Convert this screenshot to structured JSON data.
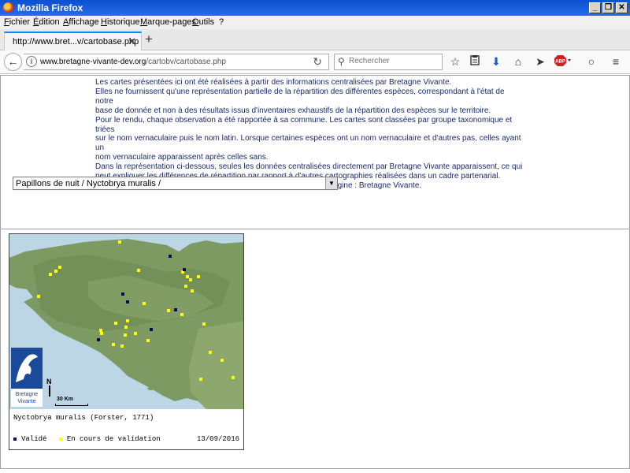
{
  "window": {
    "title": "Mozilla Firefox",
    "controls": [
      "_",
      "❐",
      "✕"
    ]
  },
  "menu": [
    "Fichier",
    "Édition",
    "Affichage",
    "Historique",
    "Marque-pages",
    "Outils",
    "?"
  ],
  "tab": {
    "label": "http://www.bret...v/cartobase.php",
    "close": "✕",
    "new": "+"
  },
  "nav": {
    "url_domain": "www.bretagne-vivante-dev.org",
    "url_path": "/cartobv/cartobase.php",
    "search_placeholder": "Rechercher",
    "adblock": "ABP"
  },
  "intro_lines": [
    "Les cartes présentées ici ont été réalisées à partir des informations centralisées par Bretagne Vivante.",
    "Elles ne fournissent qu'une représentation partielle de la répartition des différentes espèces, correspondant à l'état de notre",
    "base de donnée et non à des résultats issus d'inventaires exhaustifs de la répartition des espèces sur le territoire.",
    "Pour le rendu, chaque observation a été rapportée à sa commune. Les cartes sont classées par groupe taxonomique et triées",
    "sur le nom vernaculaire puis le nom latin. Lorsque certaines espèces ont un nom vernaculaire et d'autres pas, celles ayant un",
    "nom vernaculaire apparaissent après celles sans.",
    "Dans la représentation ci-dessous, seules les données centralisées directement par Bretagne Vivante apparaissent, ce qui",
    "peut expliquer les différences de répartition par rapport à d'autres cartographies réalisées dans un cadre partenarial.",
    "Pour toute utilisation des cartes, merci de bien vouloir en préciser l'origine : Bretagne Vivante."
  ],
  "select": {
    "value": "Papillons de nuit / Nyctobrya muralis /"
  },
  "map": {
    "species": "Nyctobrya muralis (Forster, 1771)",
    "legend_validated": "Validé",
    "legend_pending": "En cours de validation",
    "date": "13/09/2016",
    "north": "N",
    "scale": "30 Km",
    "logo_line1": "Bretagne",
    "logo_line2": "Vivante",
    "colors": {
      "validated": "#0a0a5a",
      "pending": "#ffff00",
      "sea": "#bcd6e6",
      "land": "#7a9a5e"
    }
  }
}
